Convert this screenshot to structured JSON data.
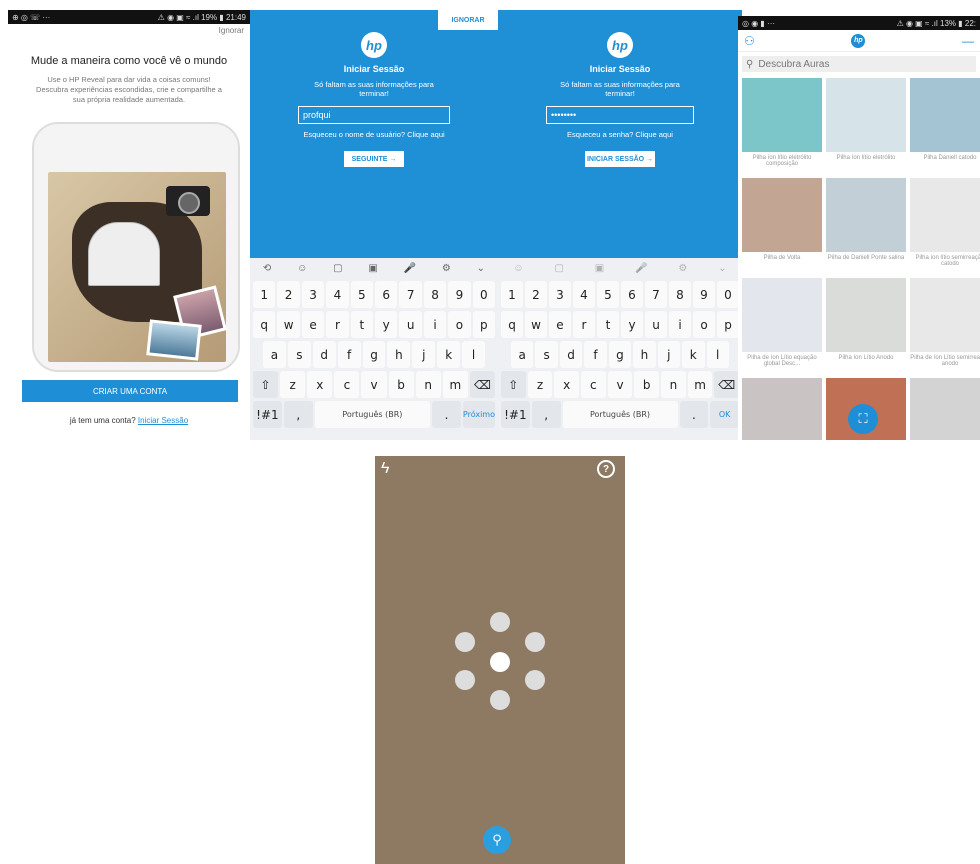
{
  "colors": {
    "accent": "#1e8fd6",
    "camera_bg": "#8e7a63"
  },
  "p1": {
    "status_left": "⊕ ◎ ☏ ···",
    "status_right": "⚠ ◉ ▣ ≈ .ıl 19% ▮ 21:49",
    "skip": "Ignorar",
    "title": "Mude a maneira como você vê o mundo",
    "subtitle": "Use o HP Reveal para dar vida a coisas comuns! Descubra experiências escondidas, crie e compartilhe a sua própria realidade aumentada.",
    "create_account": "CRIAR UMA CONTA",
    "have_account": "já tem uma conta?",
    "login_link": "Iniciar Sessão"
  },
  "login": {
    "logo": "hp",
    "title": "Iniciar Sessão",
    "subtitle": "Só faltam as suas informações para terminar!",
    "skip": "IGNORAR"
  },
  "p2": {
    "username_value": "profqui",
    "forgot": "Esqueceu o nome de usuário? Clique aqui",
    "button": "SEGUINTE →",
    "enter_key": "Próximo"
  },
  "p3": {
    "password_value": "••••••••",
    "forgot": "Esqueceu a senha? Clique aqui",
    "button": "INICIAR SESSÃO →",
    "enter_key": "OK"
  },
  "keyboard": {
    "tools": [
      "⟲",
      "☺",
      "▢",
      "▣",
      "🎤",
      "⚙",
      "⌄"
    ],
    "numbers": [
      "1",
      "2",
      "3",
      "4",
      "5",
      "6",
      "7",
      "8",
      "9",
      "0"
    ],
    "row1": [
      "q",
      "w",
      "e",
      "r",
      "t",
      "y",
      "u",
      "i",
      "o",
      "p"
    ],
    "row2": [
      "a",
      "s",
      "d",
      "f",
      "g",
      "h",
      "j",
      "k",
      "l"
    ],
    "row3": [
      "⇧",
      "z",
      "x",
      "c",
      "v",
      "b",
      "n",
      "m",
      "⌫"
    ],
    "symbols": "!#1",
    "comma": ",",
    "space": "Português (BR)",
    "period": "."
  },
  "p4": {
    "status_left": "◎ ◉ ▮ ···",
    "status_right": "⚠ ◉ ▣ ≈ .ıl 13% ▮ 22:",
    "logo": "hp",
    "search_placeholder": "Descubra Auras",
    "tiles": [
      {
        "label": "Pilha íon lítio eletrólito composição",
        "color": "#7cc6c9"
      },
      {
        "label": "Pilha íon lítio eletrólito",
        "color": "#d6e4ea"
      },
      {
        "label": "Pilha Daniell catodo",
        "color": "#a5c4d3"
      },
      {
        "label": "Pilha de Volta",
        "color": "#c2a592"
      },
      {
        "label": "Pilha de Daniell Ponte salina",
        "color": "#c3cfd6"
      },
      {
        "label": "Pilha íon lítio semirreação catodo",
        "color": "#e8e8e8"
      },
      {
        "label": "Pilha de íon Lítio equação global Desc...",
        "color": "#e3e6ec"
      },
      {
        "label": "Pilha íon Lítio Anodo",
        "color": "#d9dcd9"
      },
      {
        "label": "Pilha de íon Lítio semirreação anodo",
        "color": "#e8e8e8"
      },
      {
        "label": "",
        "color": "#c9c3c3"
      },
      {
        "label": "",
        "color": "#c07055"
      },
      {
        "label": "",
        "color": "#d3d3d3"
      }
    ],
    "fab_icon": "⛶"
  },
  "p5": {
    "flash_icon": "ϟ",
    "help_icon": "?",
    "search_icon": "⚲"
  }
}
